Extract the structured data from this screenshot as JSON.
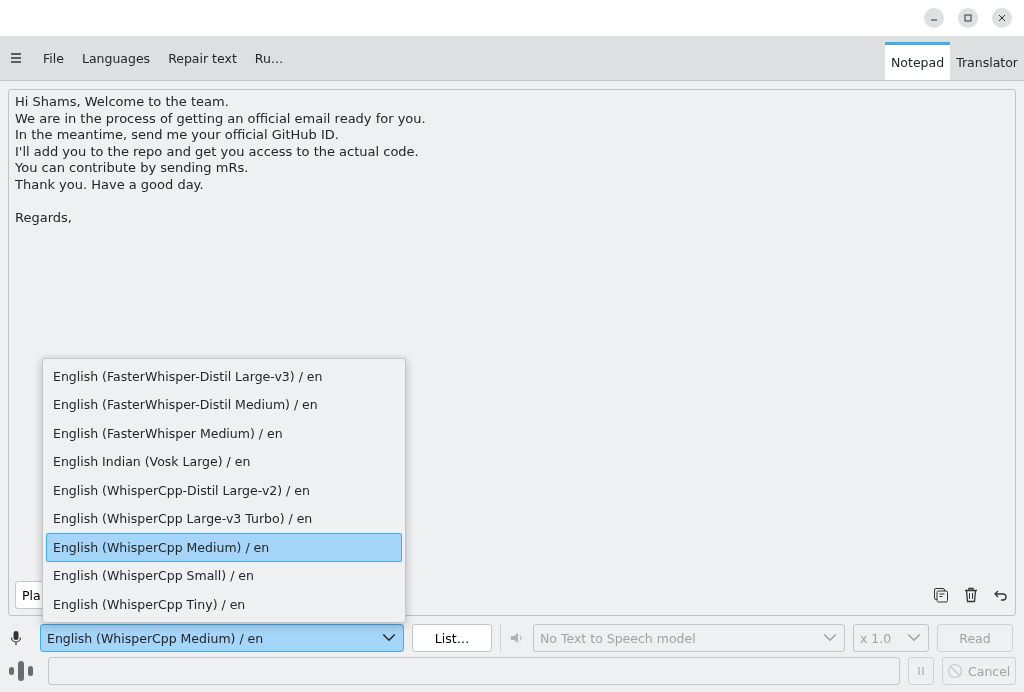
{
  "menu": {
    "items": [
      "File",
      "Languages",
      "Repair text",
      "Ru…"
    ]
  },
  "tabs": [
    {
      "label": "Notepad",
      "selected": true
    },
    {
      "label": "Translator",
      "selected": false
    }
  ],
  "editor": {
    "value": "Hi Shams, Welcome to the team.\nWe are in the process of getting an official email ready for you.\nIn the meantime, send me your official GitHub ID.\nI'll add you to the repo and get you access to the actual code.\nYou can contribute by sending mRs.\nThank you. Have a good day.\n\nRegards,",
    "button_partial": "Pla"
  },
  "model_dropdown": {
    "value": "English (WhisperCpp Medium) / en",
    "options": [
      {
        "label": "English (FasterWhisper-Distil Large-v3) / en",
        "selected": false
      },
      {
        "label": "English (FasterWhisper-Distil Medium) / en",
        "selected": false
      },
      {
        "label": "English (FasterWhisper Medium) / en",
        "selected": false
      },
      {
        "label": "English Indian (Vosk Large) / en",
        "selected": false
      },
      {
        "label": "English (WhisperCpp-Distil Large-v2) / en",
        "selected": false
      },
      {
        "label": "English (WhisperCpp Large-v3 Turbo) / en",
        "selected": false
      },
      {
        "label": "English (WhisperCpp Medium) / en",
        "selected": true
      },
      {
        "label": "English (WhisperCpp Small) / en",
        "selected": false
      },
      {
        "label": "English (WhisperCpp Tiny) / en",
        "selected": false
      }
    ]
  },
  "list_button": "List…",
  "tts": {
    "model": "No Text to Speech model",
    "speed": "x 1.0",
    "read": "Read",
    "disabled": true
  },
  "progress": {
    "level": 0
  },
  "cancel_button": "Cancel"
}
